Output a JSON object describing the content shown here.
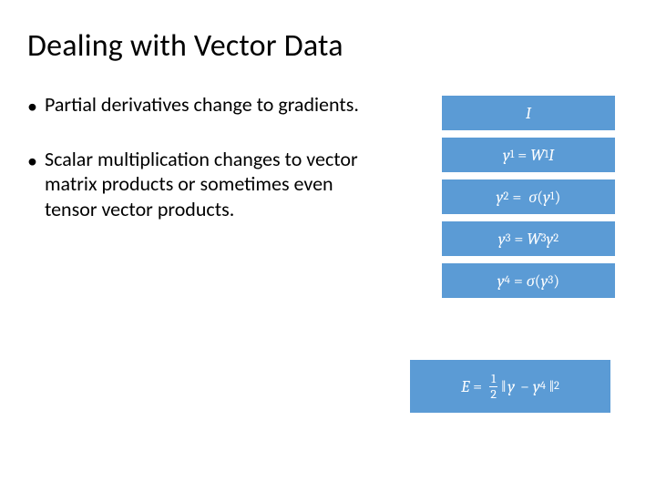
{
  "title": "Dealing with Vector Data",
  "bullets": [
    "Partial derivatives change to gradients.",
    "Scalar multiplication changes to vector matrix products or sometimes even tensor vector products."
  ],
  "equations": {
    "eq0": {
      "text": "I"
    },
    "eq1": {
      "lhs": "y",
      "lsub": "1",
      "w": "W",
      "wsub": "1",
      "rhs": "I"
    },
    "eq2": {
      "lhs": "y",
      "lsub": "2",
      "fn": "σ",
      "arg": "y",
      "argsub": "1"
    },
    "eq3": {
      "lhs": "y",
      "lsub": "3",
      "w": "W",
      "wsub": "3",
      "rhs": "y",
      "rhssub": "2"
    },
    "eq4": {
      "lhs": "y",
      "lsub": "4",
      "fn": "σ",
      "arg": "y",
      "argsub": "3"
    },
    "eq5": {
      "lhs": "E",
      "frac_n": "1",
      "frac_d": "2",
      "a": "y",
      "b": "y",
      "bsub": "4",
      "exp": "2"
    }
  }
}
